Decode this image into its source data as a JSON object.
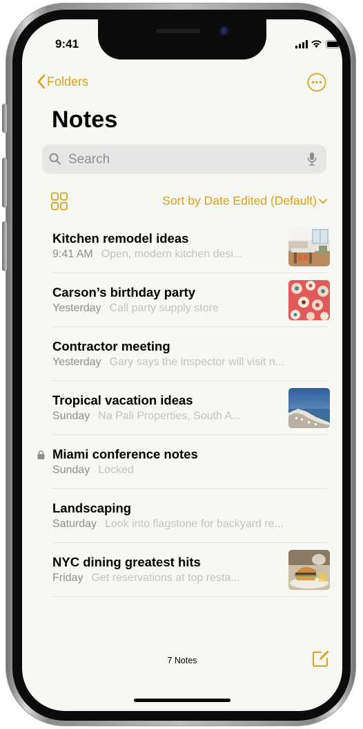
{
  "status_bar": {
    "time": "9:41"
  },
  "nav": {
    "back_label": "Folders"
  },
  "page": {
    "title": "Notes"
  },
  "search": {
    "placeholder": "Search"
  },
  "toolbar": {
    "sort_label": "Sort by Date Edited (Default)"
  },
  "notes": [
    {
      "title": "Kitchen remodel ideas",
      "date": "9:41 AM",
      "preview": "Open, modern kitchen desi...",
      "thumbnail": "kitchen-photo"
    },
    {
      "title": "Carson’s birthday party",
      "date": "Yesterday",
      "preview": "Call party supply store",
      "thumbnail": "cupcakes-photo"
    },
    {
      "title": "Contractor meeting",
      "date": "Yesterday",
      "preview": "Gary says the inspector will visit n..."
    },
    {
      "title": "Tropical vacation ideas",
      "date": "Sunday",
      "preview": "Na Pali Properties, South A...",
      "thumbnail": "coastline-photo"
    },
    {
      "title": "Miami conference notes",
      "date": "Sunday",
      "preview": "Locked",
      "icon": "lock-icon"
    },
    {
      "title": "Landscaping",
      "date": "Saturday",
      "preview": "Look into flagstone for backyard re..."
    },
    {
      "title": "NYC dining greatest hits",
      "date": "Friday",
      "preview": "Get reservations at top resta...",
      "thumbnail": "burger-photo"
    }
  ],
  "footer": {
    "count_label": "7 Notes"
  },
  "colors": {
    "accent": "#d9a21a",
    "background": "#f7f7f4",
    "search_bg": "#e7e7e5",
    "secondary_text": "#8e8e8e",
    "preview_text": "#c2c2c2"
  },
  "icons": [
    "chevron-left-icon",
    "more-icon",
    "search-icon",
    "microphone-icon",
    "gallery-view-icon",
    "chevron-down-icon",
    "lock-icon",
    "compose-icon",
    "signal-icon",
    "wifi-icon",
    "battery-icon"
  ]
}
